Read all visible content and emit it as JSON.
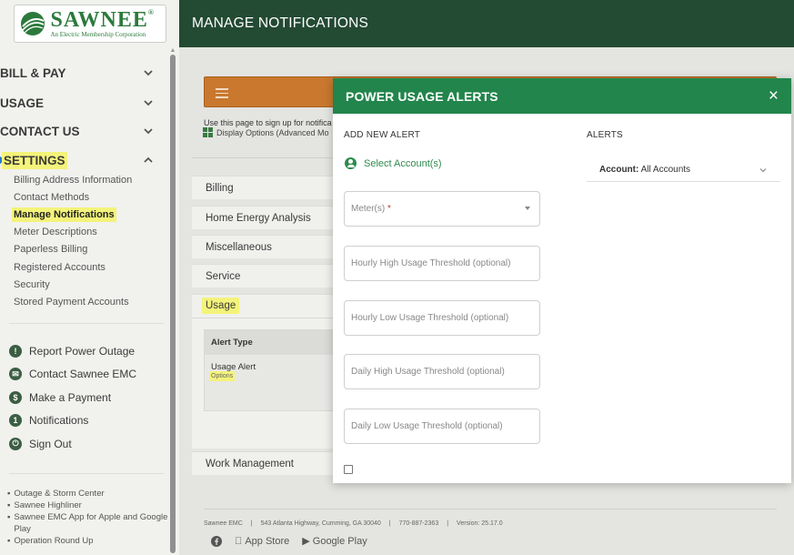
{
  "logo": {
    "name": "SAWNEE",
    "registered": "®",
    "tagline": "An Electric Membership Corporation"
  },
  "sidebar": {
    "sections": [
      {
        "label": "BILL & PAY",
        "expanded": false
      },
      {
        "label": "USAGE",
        "expanded": false
      },
      {
        "label": "CONTACT US",
        "expanded": false
      },
      {
        "label": "SETTINGS",
        "expanded": true
      }
    ],
    "settings_items": [
      "Billing Address Information",
      "Contact Methods",
      "Manage Notifications",
      "Meter Descriptions",
      "Paperless Billing",
      "Registered Accounts",
      "Security",
      "Stored Payment Accounts"
    ],
    "active_item": "Manage Notifications",
    "actions": [
      {
        "label": "Report Power Outage",
        "icon": "!"
      },
      {
        "label": "Contact Sawnee EMC",
        "icon": "✉"
      },
      {
        "label": "Make a Payment",
        "icon": "$"
      },
      {
        "label": "Notifications",
        "icon": "1"
      },
      {
        "label": "Sign Out",
        "icon": "⏻"
      }
    ],
    "links": [
      "Outage & Storm Center",
      "Sawnee Highliner",
      "Sawnee EMC App for Apple and Google Play",
      "Operation Round Up"
    ]
  },
  "header": {
    "title": "MANAGE NOTIFICATIONS"
  },
  "main": {
    "intro": "Use this page to sign up for notifica",
    "display_options": "Display Options (Advanced Mo",
    "categories": [
      "Billing",
      "Home Energy Analysis",
      "Miscellaneous",
      "Service"
    ],
    "usage": {
      "label": "Usage",
      "alert_type_header": "Alert Type",
      "alert_name": "Usage Alert",
      "options_label": "Options"
    },
    "work_management": "Work Management",
    "footer": {
      "company": "Sawnee EMC",
      "sep": "|",
      "address": "543 Atlanta Highway, Cumming, GA 30040",
      "phone": "770-887-2363",
      "version": "Version: 25.17.0",
      "app_store": "App Store",
      "google_play": "Google Play"
    }
  },
  "modal": {
    "title": "POWER USAGE ALERTS",
    "close": "×",
    "add_new_alert": "ADD NEW ALERT",
    "alerts_heading": "ALERTS",
    "select_accounts": "Select Account(s)",
    "meter_label": "Meter(s)",
    "required_mark": "*",
    "thresholds": [
      "Hourly High Usage Threshold (optional)",
      "Hourly Low Usage Threshold (optional)",
      "Daily High Usage Threshold (optional)",
      "Daily Low Usage Threshold (optional)"
    ],
    "account_label": "Account:",
    "account_value": "All Accounts"
  },
  "colors": {
    "header_bg": "#234a32",
    "modal_header_bg": "#22854c",
    "accent_orange": "#c9782e",
    "highlight": "#f4f37a",
    "marker_blue": "#2877c9"
  }
}
